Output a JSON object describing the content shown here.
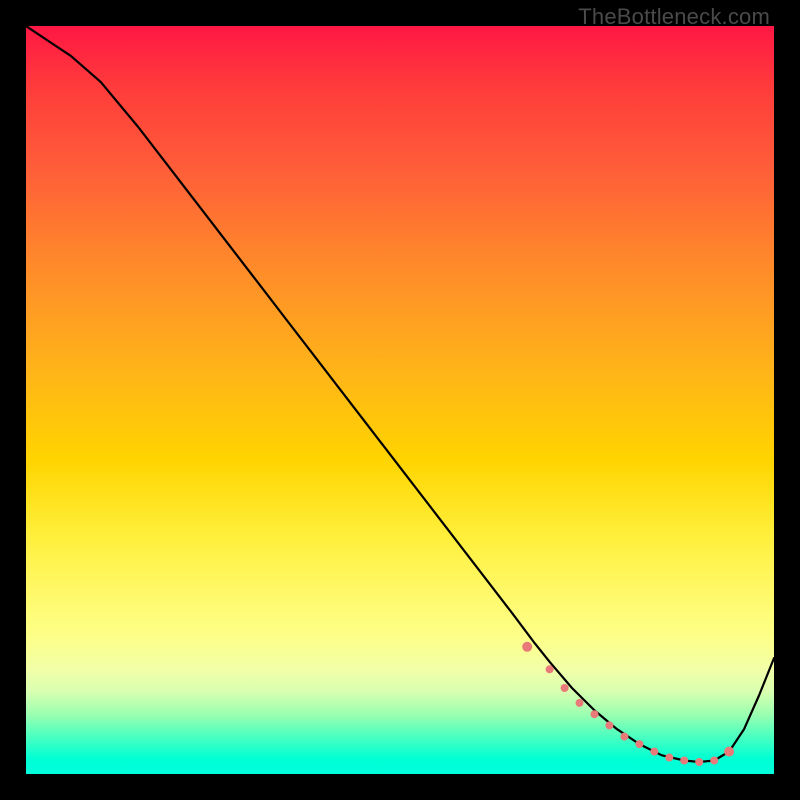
{
  "watermark": "TheBottleneck.com",
  "chart_data": {
    "type": "line",
    "title": "",
    "xlabel": "",
    "ylabel": "",
    "xlim": [
      0,
      100
    ],
    "ylim": [
      0,
      100
    ],
    "grid": false,
    "series": [
      {
        "name": "curve",
        "x": [
          0,
          3,
          6,
          10,
          15,
          20,
          25,
          30,
          35,
          40,
          45,
          50,
          55,
          60,
          65,
          68,
          70,
          73,
          76,
          79,
          82,
          85,
          88,
          90,
          92,
          94,
          96,
          98,
          100
        ],
        "y": [
          100,
          98,
          96,
          92.5,
          86.5,
          80,
          73.5,
          67,
          60.5,
          54,
          47.5,
          41,
          34.5,
          28,
          21.5,
          17.5,
          15,
          11.5,
          8.5,
          6,
          4,
          2.5,
          1.8,
          1.6,
          1.8,
          3,
          6,
          10.5,
          15.5
        ]
      },
      {
        "name": "flat-markers",
        "x": [
          67,
          70,
          72,
          74,
          76,
          78,
          80,
          82,
          84,
          86,
          88,
          90,
          92,
          94
        ],
        "y": [
          17,
          14,
          11.5,
          9.5,
          8,
          6.5,
          5,
          4,
          3,
          2.2,
          1.8,
          1.6,
          1.8,
          3
        ]
      }
    ],
    "colors": {
      "curve": "#000000",
      "markers": "#e87a7a"
    }
  }
}
